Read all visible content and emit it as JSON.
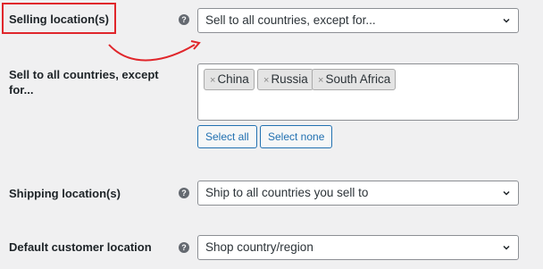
{
  "selling_location": {
    "label": "Selling location(s)",
    "help": "?",
    "value": "Sell to all countries, except for..."
  },
  "except": {
    "label": "Sell to all countries, except for...",
    "chips": [
      {
        "remove": "×",
        "name": "China"
      },
      {
        "remove": "×",
        "name": "Russia"
      },
      {
        "remove": "×",
        "name": "South Africa"
      }
    ],
    "select_all": "Select all",
    "select_none": "Select none"
  },
  "shipping_location": {
    "label": "Shipping location(s)",
    "help": "?",
    "value": "Ship to all countries you sell to"
  },
  "default_customer_location": {
    "label": "Default customer location",
    "help": "?",
    "value": "Shop country/region"
  },
  "icons": {
    "help": "help-icon",
    "dropdown": "chevron-down-icon",
    "remove": "close-icon",
    "annotation": "red-arrow"
  },
  "colors": {
    "highlight": "#e0262b",
    "button_accent": "#2271b1",
    "background": "#f0f0f1"
  }
}
